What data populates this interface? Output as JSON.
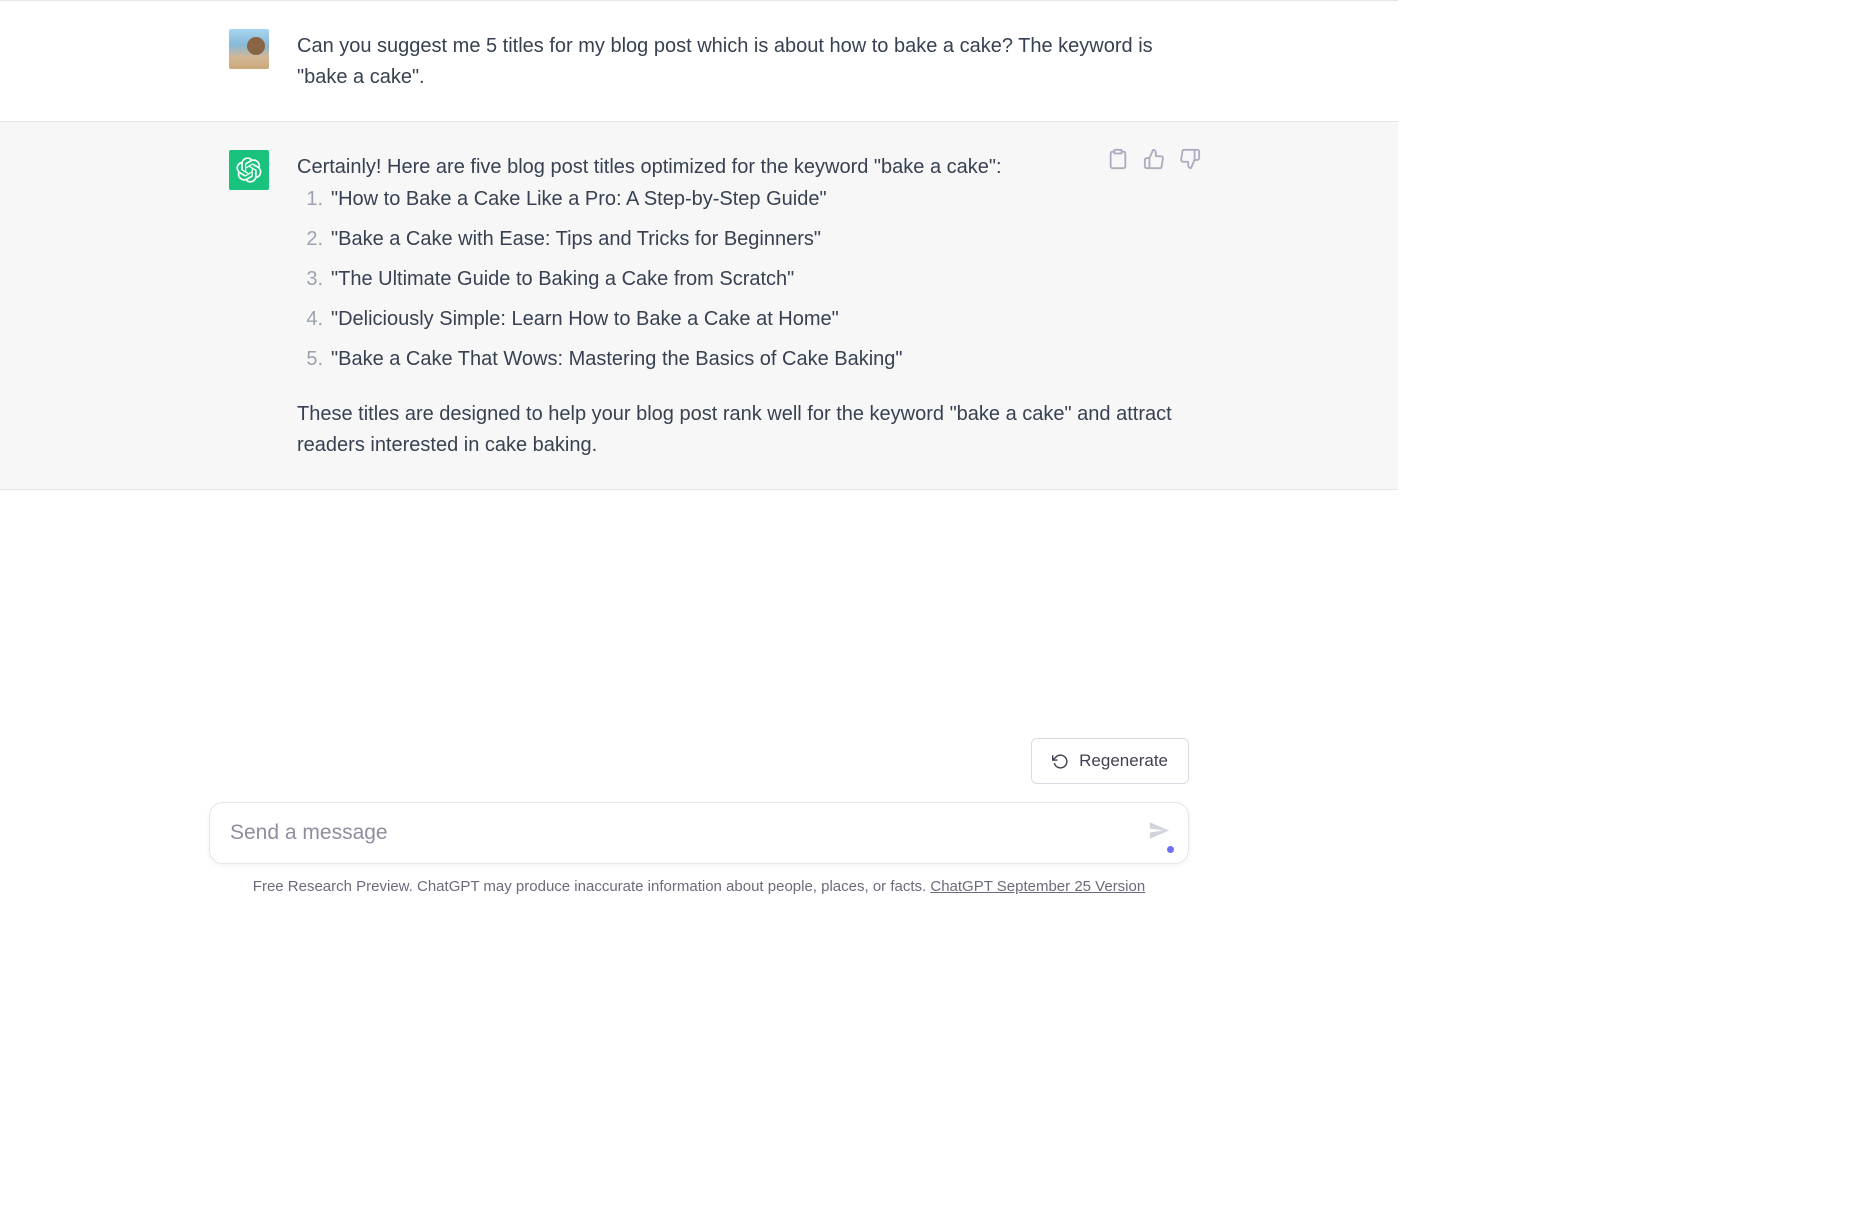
{
  "user_message": "Can you suggest me 5 titles for my blog post which is about how to bake a cake? The keyword is \"bake a cake\".",
  "assistant": {
    "intro": "Certainly! Here are five blog post titles optimized for the keyword \"bake a cake\":",
    "titles": [
      "\"How to Bake a Cake Like a Pro: A Step-by-Step Guide\"",
      "\"Bake a Cake with Ease: Tips and Tricks for Beginners\"",
      "\"The Ultimate Guide to Baking a Cake from Scratch\"",
      "\"Deliciously Simple: Learn How to Bake a Cake at Home\"",
      "\"Bake a Cake That Wows: Mastering the Basics of Cake Baking\""
    ],
    "outro": "These titles are designed to help your blog post rank well for the keyword \"bake a cake\" and attract readers interested in cake baking."
  },
  "controls": {
    "regenerate_label": "Regenerate",
    "input_placeholder": "Send a message"
  },
  "footer": {
    "note_prefix": "Free Research Preview. ChatGPT may produce inaccurate information about people, places, or facts. ",
    "version_link": "ChatGPT September 25 Version"
  }
}
